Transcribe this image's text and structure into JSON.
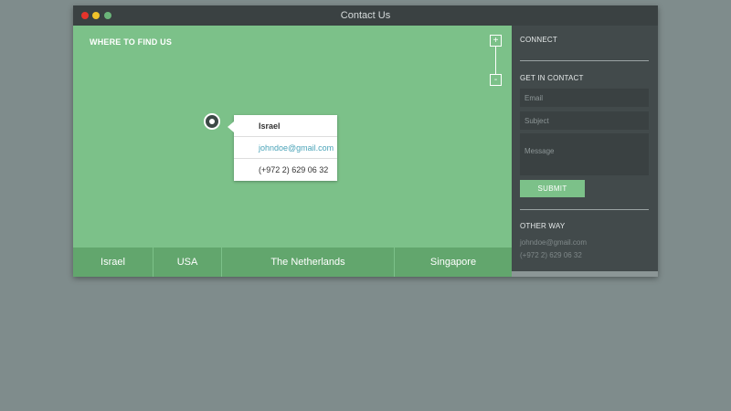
{
  "window": {
    "title": "Contact Us"
  },
  "map": {
    "heading": "WHERE TO FIND US",
    "zoom_in_label": "+",
    "zoom_out_label": "-",
    "info": {
      "name": "Israel",
      "email": "johndoe@gmail.com",
      "phone": "(+972 2) 629 06 32"
    },
    "tabs": [
      {
        "label": "Israel"
      },
      {
        "label": "USA"
      },
      {
        "label": "The Netherlands"
      },
      {
        "label": "Singapore"
      }
    ]
  },
  "sidebar": {
    "connect_heading": "CONNECT",
    "contact_heading": "GET IN CONTACT",
    "email_placeholder": "Email",
    "subject_placeholder": "Subject",
    "message_placeholder": "Message",
    "submit_label": "SUBMIT",
    "other_heading": "OTHER WAY",
    "other_email": "johndoe@gmail.com",
    "other_phone": "(+972 2) 629 06 32"
  },
  "colors": {
    "map_green": "#7cc189",
    "tab_green": "#62a66d",
    "sidebar": "#424a4b",
    "link": "#4aa3b8",
    "close_dot": "#e5342c",
    "minimize_dot": "#f0c22a",
    "maximize_dot": "#6bb57a"
  }
}
